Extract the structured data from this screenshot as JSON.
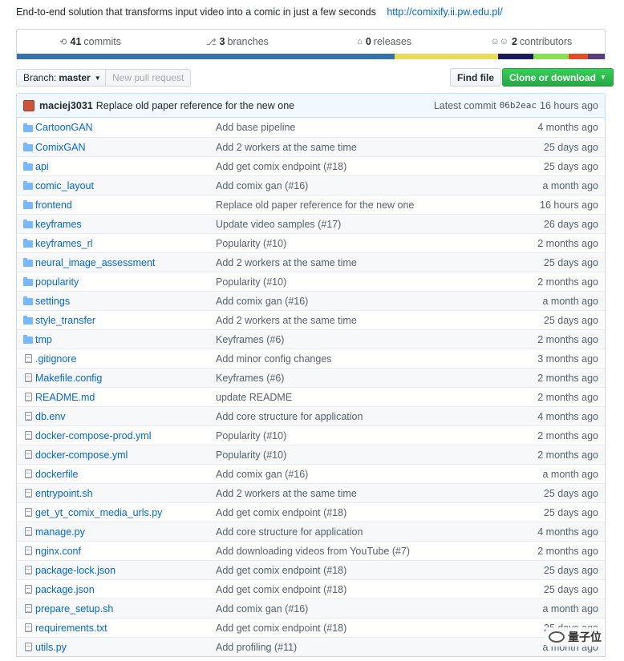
{
  "description": {
    "text": "End-to-end solution that transforms input video into a comic in just a few seconds",
    "link": "http://comixify.ii.pw.edu.pl/"
  },
  "summary": {
    "commits_count": "41",
    "commits_label": "commits",
    "branches_count": "3",
    "branches_label": "branches",
    "releases_count": "0",
    "releases_label": "releases",
    "contributors_count": "2",
    "contributors_label": "contributors",
    "language_colors": [
      {
        "color": "#3572a5",
        "share": 64.3
      },
      {
        "color": "#e6dc5a",
        "share": 17.5
      },
      {
        "color": "#1b1a5e",
        "share": 6.0
      },
      {
        "color": "#89e051",
        "share": 6.0
      },
      {
        "color": "#e34c26",
        "share": 3.4
      },
      {
        "color": "#563d7c",
        "share": 2.8
      }
    ]
  },
  "toolbar": {
    "branch_label": "Branch:",
    "branch_value": "master",
    "new_pr_label": "New pull request",
    "find_file_label": "Find file",
    "clone_label": "Clone or download"
  },
  "latest_commit": {
    "author": "maciej3031",
    "message": "Replace old paper reference for the new one",
    "prefix": "Latest commit",
    "sha": "06b2eac",
    "age": "16 hours ago"
  },
  "files": [
    {
      "type": "dir",
      "name": "CartoonGAN",
      "message": "Add base pipeline",
      "age": "4 months ago"
    },
    {
      "type": "dir",
      "name": "ComixGAN",
      "message": "Add 2 workers at the same time",
      "age": "25 days ago"
    },
    {
      "type": "dir",
      "name": "api",
      "message": "Add get comix endpoint (#18)",
      "age": "25 days ago"
    },
    {
      "type": "dir",
      "name": "comic_layout",
      "message": "Add comix gan (#16)",
      "age": "a month ago"
    },
    {
      "type": "dir",
      "name": "frontend",
      "message": "Replace old paper reference for the new one",
      "age": "16 hours ago"
    },
    {
      "type": "dir",
      "name": "keyframes",
      "message": "Update video samples (#17)",
      "age": "26 days ago"
    },
    {
      "type": "dir",
      "name": "keyframes_rl",
      "message": "Popularity (#10)",
      "age": "2 months ago"
    },
    {
      "type": "dir",
      "name": "neural_image_assessment",
      "message": "Add 2 workers at the same time",
      "age": "25 days ago"
    },
    {
      "type": "dir",
      "name": "popularity",
      "message": "Popularity (#10)",
      "age": "2 months ago"
    },
    {
      "type": "dir",
      "name": "settings",
      "message": "Add comix gan (#16)",
      "age": "a month ago"
    },
    {
      "type": "dir",
      "name": "style_transfer",
      "message": "Add 2 workers at the same time",
      "age": "25 days ago"
    },
    {
      "type": "dir",
      "name": "tmp",
      "message": "Keyframes (#6)",
      "age": "2 months ago"
    },
    {
      "type": "file",
      "name": ".gitignore",
      "message": "Add minor config changes",
      "age": "3 months ago"
    },
    {
      "type": "file",
      "name": "Makefile.config",
      "message": "Keyframes (#6)",
      "age": "2 months ago"
    },
    {
      "type": "file",
      "name": "README.md",
      "message": "update README",
      "age": "2 months ago"
    },
    {
      "type": "file",
      "name": "db.env",
      "message": "Add core structure for application",
      "age": "4 months ago"
    },
    {
      "type": "file",
      "name": "docker-compose-prod.yml",
      "message": "Popularity (#10)",
      "age": "2 months ago"
    },
    {
      "type": "file",
      "name": "docker-compose.yml",
      "message": "Popularity (#10)",
      "age": "2 months ago"
    },
    {
      "type": "file",
      "name": "dockerfile",
      "message": "Add comix gan (#16)",
      "age": "a month ago"
    },
    {
      "type": "file",
      "name": "entrypoint.sh",
      "message": "Add 2 workers at the same time",
      "age": "25 days ago"
    },
    {
      "type": "file",
      "name": "get_yt_comix_media_urls.py",
      "message": "Add get comix endpoint (#18)",
      "age": "25 days ago"
    },
    {
      "type": "file",
      "name": "manage.py",
      "message": "Add core structure for application",
      "age": "4 months ago"
    },
    {
      "type": "file",
      "name": "nginx.conf",
      "message": "Add downloading videos from YouTube (#7)",
      "age": "2 months ago"
    },
    {
      "type": "file",
      "name": "package-lock.json",
      "message": "Add get comix endpoint (#18)",
      "age": "25 days ago"
    },
    {
      "type": "file",
      "name": "package.json",
      "message": "Add get comix endpoint (#18)",
      "age": "25 days ago"
    },
    {
      "type": "file",
      "name": "prepare_setup.sh",
      "message": "Add comix gan (#16)",
      "age": "a month ago"
    },
    {
      "type": "file",
      "name": "requirements.txt",
      "message": "Add get comix endpoint (#18)",
      "age": "25 days ago"
    },
    {
      "type": "file",
      "name": "utils.py",
      "message": "Add profiling (#11)",
      "age": "a month ago"
    }
  ],
  "watermark": {
    "text": "量子位"
  }
}
